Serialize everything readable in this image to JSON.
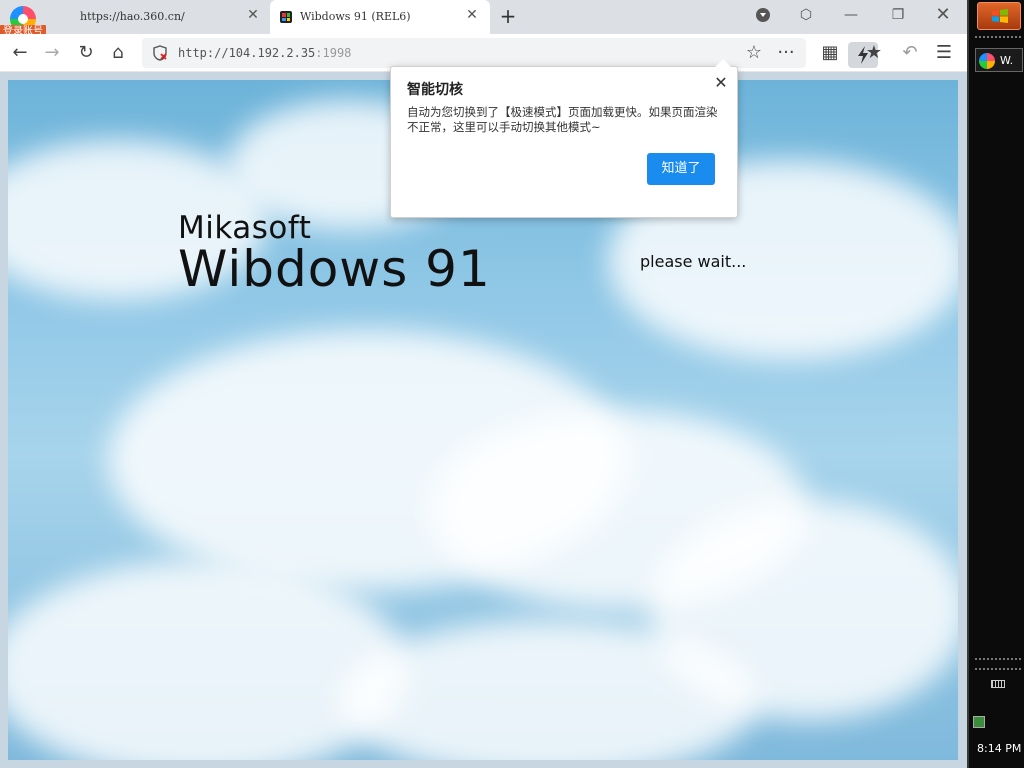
{
  "profile": {
    "login_label": "登录账号"
  },
  "tabs": [
    {
      "title": "https://hao.360.cn/",
      "close": "✕"
    },
    {
      "title": "Wibdows 91 (REL6)",
      "close": "✕"
    }
  ],
  "newtab_label": "+",
  "window_controls": {
    "skin": "⬡",
    "minimize": "—",
    "maximize": "❐",
    "close": "✕"
  },
  "toolbar": {
    "back": "←",
    "forward": "→",
    "reload": "↻",
    "home": "⌂",
    "url_host": "http://104.192.2.35",
    "url_port": ":1998",
    "star": "☆",
    "more": "···",
    "grid": "▦",
    "favorites": "★",
    "undo": "↶",
    "menu": "☰"
  },
  "page": {
    "brand": "Mikasoft",
    "product": "Wibdows 91",
    "status": "please wait..."
  },
  "popup": {
    "title": "智能切核",
    "close": "✕",
    "body": "自动为您切换到了【极速模式】页面加载更快。如果页面渲染不正常，这里可以手动切换其他模式~",
    "button": "知道了"
  },
  "taskbar": {
    "task_label": "W.",
    "clock": "8:14 PM"
  },
  "colors": {
    "accent": "#1a8cf0",
    "sky": "#8fc7e6",
    "start": "#e0662a"
  }
}
